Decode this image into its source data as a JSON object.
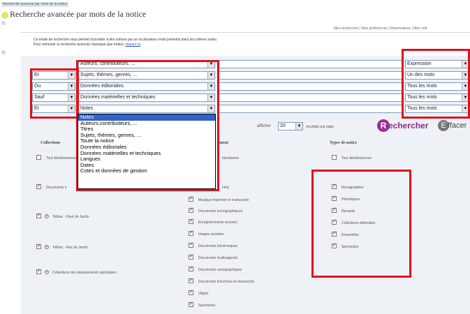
{
  "breadcrumb": "Recherche avancée par mots de la notice",
  "page_title": "Recherche avancée par mots de la notice",
  "topnav": {
    "recherches": "Mes recherches",
    "preferences": "Mes préférences",
    "reservations": "Réservations",
    "more": "Mes noti"
  },
  "intro": {
    "line1": "Ce mode de recherche vous permet d'accéder à des notices par un ou plusieurs mots présents dans les critères saisis.",
    "line2_prefix": "Pour retrouver la recherche avancée classique (par index),",
    "line2_link": "cliquez ici"
  },
  "rows": [
    {
      "operator": "",
      "field": "Auteurs, contributeurs, ...",
      "mode": "Expression"
    },
    {
      "operator": "Et",
      "field": "Sujets, thèmes, genres, ...",
      "mode": "Un des mots"
    },
    {
      "operator": "Ou",
      "field": "Données éditoriales",
      "mode": "Tous les mots"
    },
    {
      "operator": "Sauf",
      "field": "Données matérielles et techniques",
      "mode": "Tous les mots"
    },
    {
      "operator": "Et",
      "field": "Notes",
      "mode": "Tous les mots"
    }
  ],
  "dropdown_options": [
    "Notes",
    "Auteurs,contributeurs, ...",
    "Titres",
    "Sujets, thèmes, genres, ...",
    "Toute la notice",
    "Données éditoriales",
    "Données matérielles et techniques",
    "Langues",
    "Dates",
    "Cotes et données de gestion"
  ],
  "results": {
    "label_before": "afficher",
    "value": "20",
    "label_after": "résultats par page"
  },
  "buttons": {
    "search": "Rechercher",
    "search_initial": "R",
    "search_rest": "echercher",
    "clear": "Effacer",
    "clear_initial": "E",
    "clear_rest": "ffacer"
  },
  "columns": {
    "collections": {
      "header": "Collections",
      "items": [
        {
          "label": "Tout désélectionner",
          "checked": false
        },
        {
          "label": "Documents n",
          "checked": true
        },
        {
          "label": "Tolbiac - Haut de Jardin",
          "checked": true
        },
        {
          "label": "Tolbiac - Rez de Jardin",
          "checked": true
        },
        {
          "label": "Collections des départements spécialisés",
          "checked": true
        }
      ]
    },
    "documents": {
      "header": "ment",
      "items": [
        {
          "label": "électionner",
          "checked": false
        },
        {
          "label": "rimé",
          "checked": true
        },
        {
          "label": "Musique imprimée et manuscrite",
          "checked": true
        },
        {
          "label": "Documents iconographiques",
          "checked": true
        },
        {
          "label": "Enregistrements sonores",
          "checked": true
        },
        {
          "label": "Images animées",
          "checked": true
        },
        {
          "label": "Documents électroniques",
          "checked": true
        },
        {
          "label": "Documents multisupports",
          "checked": true
        },
        {
          "label": "Documents cartographiques",
          "checked": true
        },
        {
          "label": "Documents d'archives et manuscrits",
          "checked": true
        },
        {
          "label": "Objets",
          "checked": true
        },
        {
          "label": "Spectacles",
          "checked": true
        }
      ]
    },
    "types": {
      "header": "Types de notice",
      "items": [
        {
          "label": "Tout désélectionner",
          "checked": false
        },
        {
          "label": "Monographies",
          "checked": true
        },
        {
          "label": "Périodiques",
          "checked": true
        },
        {
          "label": "Recueils",
          "checked": true
        },
        {
          "label": "Collections éditoriales",
          "checked": true
        },
        {
          "label": "Ensembles",
          "checked": true
        },
        {
          "label": "Spectacles",
          "checked": true
        }
      ]
    }
  },
  "colors": {
    "highlight": "#e0121b",
    "accent": "#9b2f97",
    "selection": "#3162c8"
  }
}
